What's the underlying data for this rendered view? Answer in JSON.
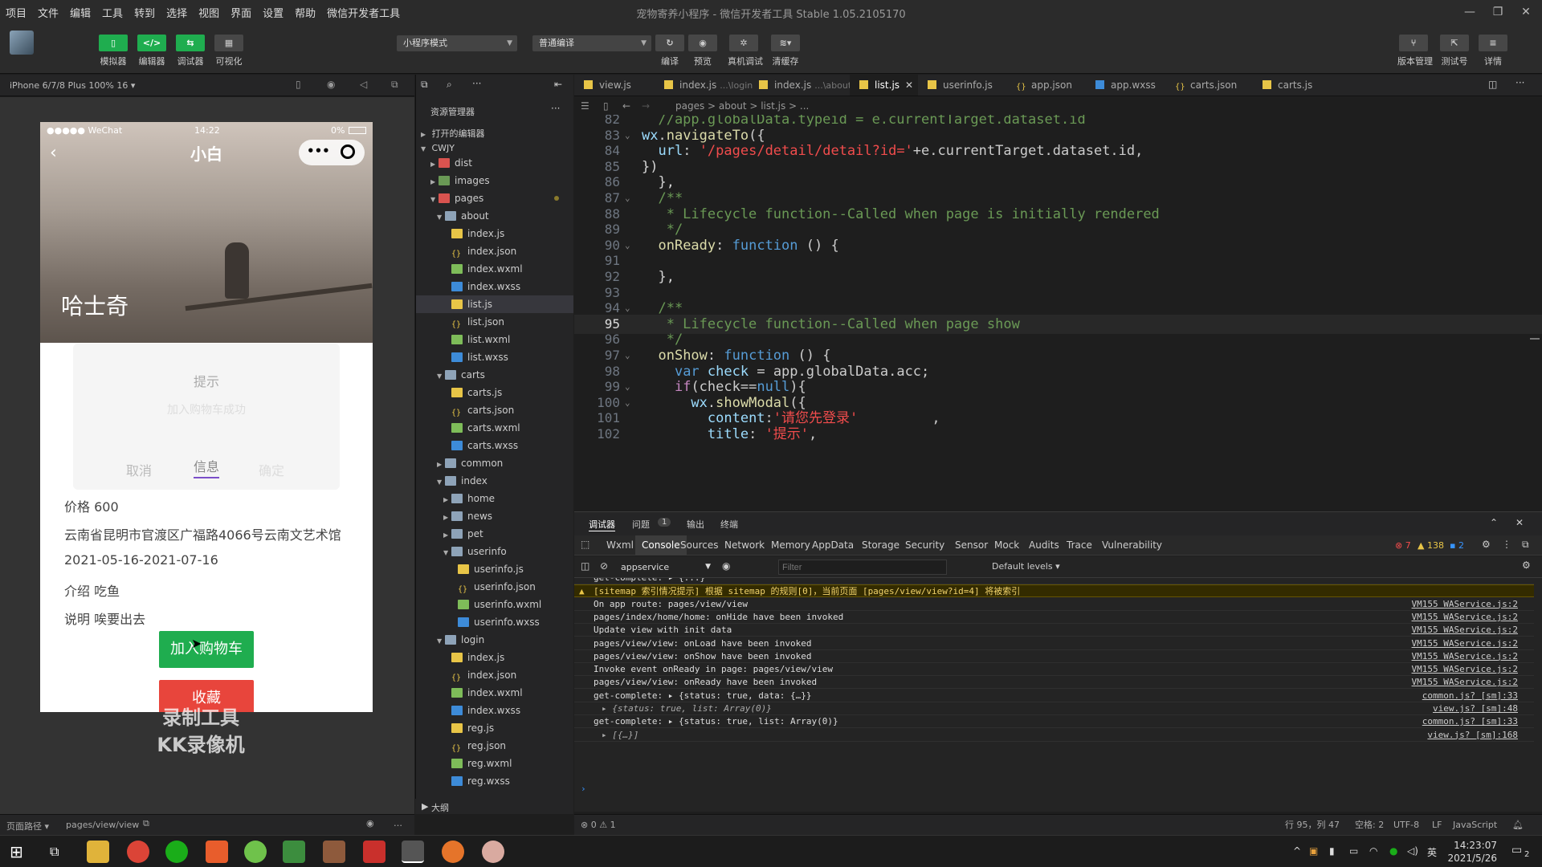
{
  "menu": [
    "项目",
    "文件",
    "编辑",
    "工具",
    "转到",
    "选择",
    "视图",
    "界面",
    "设置",
    "帮助",
    "微信开发者工具"
  ],
  "window_title": "宠物寄养小程序 - 微信开发者工具 Stable 1.05.2105170",
  "toolbar": {
    "simulator": "模拟器",
    "editor": "编辑器",
    "debugger": "调试器",
    "visualize": "可视化",
    "mode_select": "小程序模式",
    "compile_select": "普通编译",
    "compile": "编译",
    "preview": "预览",
    "remote_debug": "真机调试",
    "clear_cache": "清缓存",
    "version_mgmt": "版本管理",
    "test_account": "测试号",
    "details": "详情"
  },
  "simulator": {
    "device": "iPhone 6/7/8 Plus 100% 16 ▾",
    "status_left": "●●●●● WeChat",
    "status_time": "14:22",
    "status_battery": "0%",
    "page_title": "小白",
    "dog_name": "哈士奇",
    "modal_title": "提示",
    "modal_content": "加入购物车成功",
    "modal_cancel": "取消",
    "modal_info": "信息",
    "modal_confirm": "确定",
    "price": "价格 600",
    "address": "云南省昆明市官渡区广福路4066号云南文艺术馆",
    "dates": "2021-05-16-2021-07-16",
    "intro": "介绍 吃鱼",
    "note": "说明 唉要出去",
    "add_cart": "加入购物车",
    "favorite": "收藏",
    "watermark_line1": "录制工具",
    "watermark_line2": "KK录像机",
    "footer_label": "页面路径 ▾",
    "footer_path": "pages/view/view"
  },
  "explorer": {
    "title": "资源管理器",
    "open_editors": "打开的编辑器",
    "root": "CWJY",
    "outline": "大纲",
    "tree": [
      {
        "name": "dist",
        "type": "folder red",
        "depth": 2,
        "tw": "▶"
      },
      {
        "name": "images",
        "type": "folder green",
        "depth": 2,
        "tw": "▶"
      },
      {
        "name": "pages",
        "type": "folder red",
        "depth": 2,
        "tw": "▼"
      },
      {
        "name": "about",
        "type": "folder",
        "depth": 3,
        "tw": "▼"
      },
      {
        "name": "index.js",
        "type": "js",
        "depth": 4,
        "tw": ""
      },
      {
        "name": "index.json",
        "type": "json",
        "depth": 4,
        "tw": ""
      },
      {
        "name": "index.wxml",
        "type": "wxml",
        "depth": 4,
        "tw": ""
      },
      {
        "name": "index.wxss",
        "type": "wxss",
        "depth": 4,
        "tw": ""
      },
      {
        "name": "list.js",
        "type": "js",
        "depth": 4,
        "tw": "",
        "active": true
      },
      {
        "name": "list.json",
        "type": "json",
        "depth": 4,
        "tw": ""
      },
      {
        "name": "list.wxml",
        "type": "wxml",
        "depth": 4,
        "tw": ""
      },
      {
        "name": "list.wxss",
        "type": "wxss",
        "depth": 4,
        "tw": ""
      },
      {
        "name": "carts",
        "type": "folder",
        "depth": 3,
        "tw": "▼"
      },
      {
        "name": "carts.js",
        "type": "js",
        "depth": 4,
        "tw": ""
      },
      {
        "name": "carts.json",
        "type": "json",
        "depth": 4,
        "tw": ""
      },
      {
        "name": "carts.wxml",
        "type": "wxml",
        "depth": 4,
        "tw": ""
      },
      {
        "name": "carts.wxss",
        "type": "wxss",
        "depth": 4,
        "tw": ""
      },
      {
        "name": "common",
        "type": "folder",
        "depth": 3,
        "tw": "▶"
      },
      {
        "name": "index",
        "type": "folder",
        "depth": 3,
        "tw": "▼"
      },
      {
        "name": "home",
        "type": "folder",
        "depth": 4,
        "tw": "▶"
      },
      {
        "name": "news",
        "type": "folder",
        "depth": 4,
        "tw": "▶"
      },
      {
        "name": "pet",
        "type": "folder",
        "depth": 4,
        "tw": "▶"
      },
      {
        "name": "userinfo",
        "type": "folder",
        "depth": 4,
        "tw": "▼"
      },
      {
        "name": "userinfo.js",
        "type": "js",
        "depth": 5,
        "tw": ""
      },
      {
        "name": "userinfo.json",
        "type": "json",
        "depth": 5,
        "tw": ""
      },
      {
        "name": "userinfo.wxml",
        "type": "wxml",
        "depth": 5,
        "tw": ""
      },
      {
        "name": "userinfo.wxss",
        "type": "wxss",
        "depth": 5,
        "tw": ""
      },
      {
        "name": "login",
        "type": "folder",
        "depth": 3,
        "tw": "▼"
      },
      {
        "name": "index.js",
        "type": "js",
        "depth": 4,
        "tw": ""
      },
      {
        "name": "index.json",
        "type": "json",
        "depth": 4,
        "tw": ""
      },
      {
        "name": "index.wxml",
        "type": "wxml",
        "depth": 4,
        "tw": ""
      },
      {
        "name": "index.wxss",
        "type": "wxss",
        "depth": 4,
        "tw": ""
      },
      {
        "name": "reg.js",
        "type": "js",
        "depth": 4,
        "tw": ""
      },
      {
        "name": "reg.json",
        "type": "json",
        "depth": 4,
        "tw": ""
      },
      {
        "name": "reg.wxml",
        "type": "wxml",
        "depth": 4,
        "tw": ""
      },
      {
        "name": "reg.wxss",
        "type": "wxss",
        "depth": 4,
        "tw": ""
      }
    ]
  },
  "tabs": [
    {
      "name": "view.js",
      "sub": "",
      "active": false
    },
    {
      "name": "index.js",
      "sub": "...\\login",
      "active": false
    },
    {
      "name": "index.js",
      "sub": "...\\about",
      "active": false
    },
    {
      "name": "list.js",
      "sub": "",
      "active": true
    },
    {
      "name": "userinfo.js",
      "sub": "",
      "active": false
    },
    {
      "name": "app.json",
      "sub": "",
      "active": false
    },
    {
      "name": "app.wxss",
      "sub": "",
      "active": false
    },
    {
      "name": "carts.json",
      "sub": "",
      "active": false
    },
    {
      "name": "carts.js",
      "sub": "",
      "active": false
    }
  ],
  "breadcrumb": "pages > about > list.js > ...",
  "code": [
    {
      "n": "82",
      "t": "  //app.globalData.typeid = e.currentTarget.dataset.id",
      "cls": "c",
      "fold": ""
    },
    {
      "n": "83",
      "t": "wx.navigateTo({",
      "cls": "f",
      "fold": "v"
    },
    {
      "n": "84",
      "t": "  url: '/pages/detail/detail?id='+e.currentTarget.dataset.id,",
      "cls": "mix",
      "fold": ""
    },
    {
      "n": "85",
      "t": "})",
      "cls": "p",
      "fold": ""
    },
    {
      "n": "86",
      "t": "  },",
      "cls": "p",
      "fold": ""
    },
    {
      "n": "87",
      "t": "  /**",
      "cls": "c",
      "fold": "v"
    },
    {
      "n": "88",
      "t": "   * Lifecycle function--Called when page is initially rendered",
      "cls": "c",
      "fold": ""
    },
    {
      "n": "89",
      "t": "   */",
      "cls": "c",
      "fold": ""
    },
    {
      "n": "90",
      "t": "  onReady: function () {",
      "cls": "fn",
      "fold": "v"
    },
    {
      "n": "91",
      "t": "",
      "cls": "p",
      "fold": ""
    },
    {
      "n": "92",
      "t": "  },",
      "cls": "p",
      "fold": ""
    },
    {
      "n": "93",
      "t": "",
      "cls": "p",
      "fold": ""
    },
    {
      "n": "94",
      "t": "  /**",
      "cls": "c",
      "fold": "v"
    },
    {
      "n": "95",
      "t": "   * Lifecycle function--Called when page show",
      "cls": "c",
      "fold": "",
      "cur": true
    },
    {
      "n": "96",
      "t": "   */",
      "cls": "c",
      "fold": ""
    },
    {
      "n": "97",
      "t": "  onShow: function () {",
      "cls": "fn",
      "fold": "v"
    },
    {
      "n": "98",
      "t": "    var check = app.globalData.acc;",
      "cls": "var",
      "fold": ""
    },
    {
      "n": "99",
      "t": "    if(check==null){",
      "cls": "if",
      "fold": "v"
    },
    {
      "n": "100",
      "t": "      wx.showModal({",
      "cls": "f",
      "fold": "v"
    },
    {
      "n": "101",
      "t": "        content:'请您先登录'         ,",
      "cls": "str",
      "fold": ""
    },
    {
      "n": "102",
      "t": "        title: '提示',",
      "cls": "str",
      "fold": ""
    }
  ],
  "panel_tabs": [
    "调试器",
    "问题",
    "输出",
    "终端"
  ],
  "problems_count": "1",
  "devtools_tabs": [
    "Wxml",
    "Console",
    "Sources",
    "Network",
    "Memory",
    "AppData",
    "Storage",
    "Security",
    "Sensor",
    "Mock",
    "Audits",
    "Trace",
    "Vulnerability"
  ],
  "devtools_active": "Console",
  "counts": {
    "errors": "7",
    "warnings": "138",
    "info": "2"
  },
  "context_select": "appservice",
  "filter_placeholder": "Filter",
  "levels": "Default levels ▾",
  "console": [
    {
      "msg": "get-complete: ▸ {...}",
      "src": "",
      "type": "cut"
    },
    {
      "msg": "[sitemap 索引情况提示] 根据 sitemap 的规则[0]，当前页面 [pages/view/view?id=4] 将被索引",
      "src": "",
      "type": "warn"
    },
    {
      "msg": "On app route: pages/view/view",
      "src": "VM155 WAService.js:2",
      "type": ""
    },
    {
      "msg": "pages/index/home/home: onHide have been invoked",
      "src": "VM155 WAService.js:2",
      "type": ""
    },
    {
      "msg": "Update view with init data",
      "src": "VM155 WAService.js:2",
      "type": ""
    },
    {
      "msg": "pages/view/view: onLoad have been invoked",
      "src": "VM155 WAService.js:2",
      "type": ""
    },
    {
      "msg": "pages/view/view: onShow have been invoked",
      "src": "VM155 WAService.js:2",
      "type": ""
    },
    {
      "msg": "Invoke event onReady in page: pages/view/view",
      "src": "VM155 WAService.js:2",
      "type": ""
    },
    {
      "msg": "pages/view/view: onReady have been invoked",
      "src": "VM155 WAService.js:2",
      "type": ""
    },
    {
      "msg": "get-complete: ▸ {status: true, data: {…}}",
      "src": "common.js? [sm]:33",
      "type": ""
    },
    {
      "msg": "▸ {status: true, list: Array(0)}",
      "src": "view.js? [sm]:48",
      "type": "ital"
    },
    {
      "msg": "get-complete: ▸ {status: true, list: Array(0)}",
      "src": "common.js? [sm]:33",
      "type": ""
    },
    {
      "msg": "▸ [{…}]",
      "src": "view.js? [sm]:168",
      "type": "ital"
    }
  ],
  "status": {
    "position": "行 95，列 47",
    "spaces": "空格: 2",
    "encoding": "UTF-8",
    "eol": "LF",
    "language": "JavaScript",
    "errors_warnings": "⊗ 0 ⚠ 1"
  },
  "taskbar": {
    "time": "14:23:07",
    "date": "2021/5/26",
    "ime": "英",
    "notif": "2"
  },
  "colors": {
    "green": "#1fad4f",
    "red": "#e8453c",
    "accent": "#3794ff"
  }
}
